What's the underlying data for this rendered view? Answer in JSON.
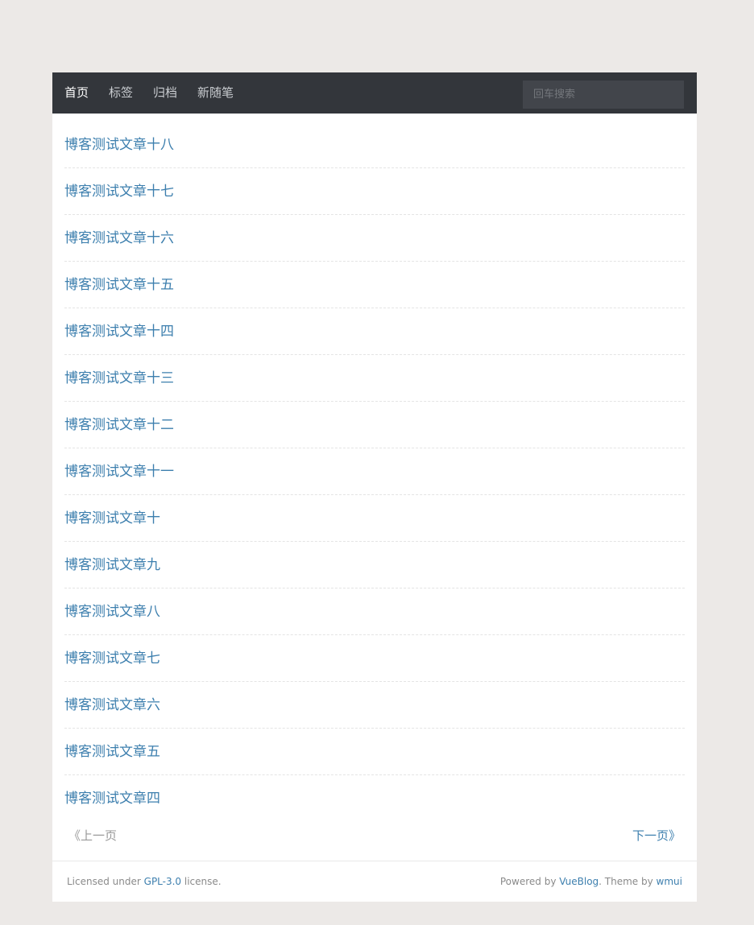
{
  "nav": {
    "items": [
      "首页",
      "标签",
      "归档",
      "新随笔"
    ],
    "active_index": 0,
    "search_placeholder": "回车搜索"
  },
  "posts": [
    "博客测试文章十八",
    "博客测试文章十七",
    "博客测试文章十六",
    "博客测试文章十五",
    "博客测试文章十四",
    "博客测试文章十三",
    "博客测试文章十二",
    "博客测试文章十一",
    "博客测试文章十",
    "博客测试文章九",
    "博客测试文章八",
    "博客测试文章七",
    "博客测试文章六",
    "博客测试文章五",
    "博客测试文章四"
  ],
  "pager": {
    "prev_label": "《上一页",
    "next_label": "下一页》"
  },
  "footer": {
    "left_prefix": "Licensed under ",
    "license_link": "GPL-3.0",
    "left_suffix": " license.",
    "right_prefix": "Powered by ",
    "powered_link": "VueBlog",
    "right_mid": ". Theme by ",
    "theme_link": "wmui"
  },
  "colors": {
    "navbar_bg": "#33363b",
    "link": "#3d7fae",
    "page_bg": "#ece9e7"
  }
}
